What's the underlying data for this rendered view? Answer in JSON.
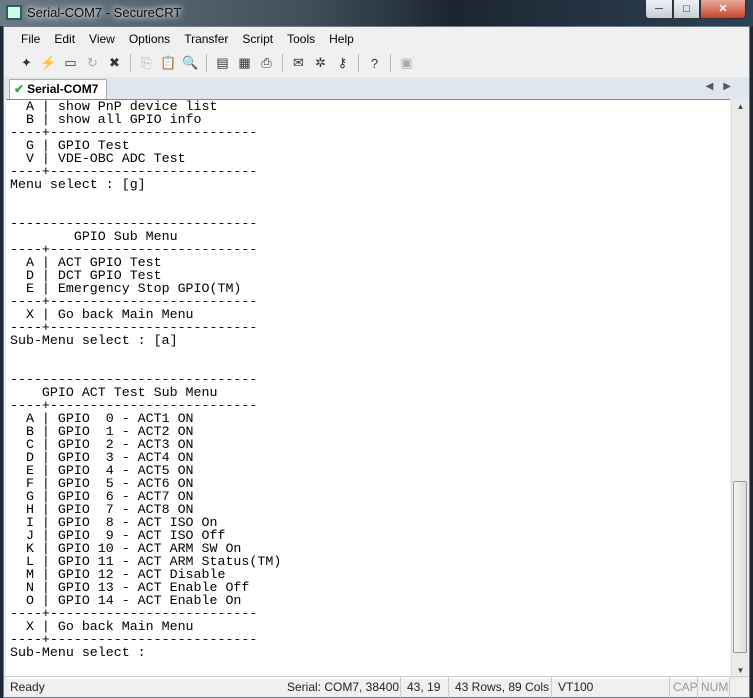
{
  "window": {
    "title": "Serial-COM7 - SecureCRT",
    "minimize": "─",
    "maximize": "□",
    "close": "✕"
  },
  "menu": [
    "File",
    "Edit",
    "View",
    "Options",
    "Transfer",
    "Script",
    "Tools",
    "Help"
  ],
  "toolbar": [
    {
      "icon": "quick-connect-icon",
      "glyph": "✦",
      "enabled": true
    },
    {
      "icon": "connect-in-tab-icon",
      "glyph": "⚡",
      "enabled": true
    },
    {
      "icon": "reconnect-icon",
      "glyph": "▭",
      "enabled": true
    },
    {
      "icon": "reconnect-all-icon",
      "glyph": "↻",
      "enabled": false
    },
    {
      "icon": "disconnect-icon",
      "glyph": "✖",
      "enabled": true
    },
    {
      "sep": true
    },
    {
      "icon": "copy-icon",
      "glyph": "⎘",
      "enabled": false
    },
    {
      "icon": "paste-icon",
      "glyph": "📋",
      "enabled": false
    },
    {
      "icon": "find-icon",
      "glyph": "🔍",
      "enabled": true
    },
    {
      "sep": true
    },
    {
      "icon": "print-screen-icon",
      "glyph": "▤",
      "enabled": true
    },
    {
      "icon": "print-selection-icon",
      "glyph": "▦",
      "enabled": true
    },
    {
      "icon": "print-icon",
      "glyph": "⎙",
      "enabled": true
    },
    {
      "sep": true
    },
    {
      "icon": "session-options-icon",
      "glyph": "✉",
      "enabled": true
    },
    {
      "icon": "global-options-icon",
      "glyph": "✲",
      "enabled": true
    },
    {
      "icon": "keymap-icon",
      "glyph": "⚷",
      "enabled": true
    },
    {
      "sep": true
    },
    {
      "icon": "help-icon",
      "glyph": "?",
      "enabled": true
    },
    {
      "sep": true
    },
    {
      "icon": "lock-icon",
      "glyph": "▣",
      "enabled": false
    }
  ],
  "tab": {
    "label": "Serial-COM7",
    "status": "connected"
  },
  "terminal": {
    "lines": [
      "  A | show PnP device list",
      "  B | show all GPIO info",
      "----+--------------------------",
      "  G | GPIO Test",
      "  V | VDE-OBC ADC Test",
      "----+--------------------------",
      "Menu select : [g]",
      "",
      "",
      "-------------------------------",
      "        GPIO Sub Menu",
      "----+--------------------------",
      "  A | ACT GPIO Test",
      "  D | DCT GPIO Test",
      "  E | Emergency Stop GPIO(TM)",
      "----+--------------------------",
      "  X | Go back Main Menu",
      "----+--------------------------",
      "Sub-Menu select : [a]",
      "",
      "",
      "-------------------------------",
      "    GPIO ACT Test Sub Menu",
      "----+--------------------------",
      "  A | GPIO  0 - ACT1 ON",
      "  B | GPIO  1 - ACT2 ON",
      "  C | GPIO  2 - ACT3 ON",
      "  D | GPIO  3 - ACT4 ON",
      "  E | GPIO  4 - ACT5 ON",
      "  F | GPIO  5 - ACT6 ON",
      "  G | GPIO  6 - ACT7 ON",
      "  H | GPIO  7 - ACT8 ON",
      "  I | GPIO  8 - ACT ISO On",
      "  J | GPIO  9 - ACT ISO Off",
      "  K | GPIO 10 - ACT ARM SW On",
      "  L | GPIO 11 - ACT ARM Status(TM)",
      "  M | GPIO 12 - ACT Disable",
      "  N | GPIO 13 - ACT Enable Off",
      "  O | GPIO 14 - ACT Enable On",
      "----+--------------------------",
      "  X | Go back Main Menu",
      "----+--------------------------",
      "Sub-Menu select : "
    ],
    "scroll_position": 0.98
  },
  "status": {
    "ready": "Ready",
    "connection": "Serial: COM7, 38400",
    "cursor": "43,  19",
    "size": "43 Rows,  89 Cols",
    "emulation": "VT100",
    "cap": "CAP",
    "num": "NUM"
  }
}
